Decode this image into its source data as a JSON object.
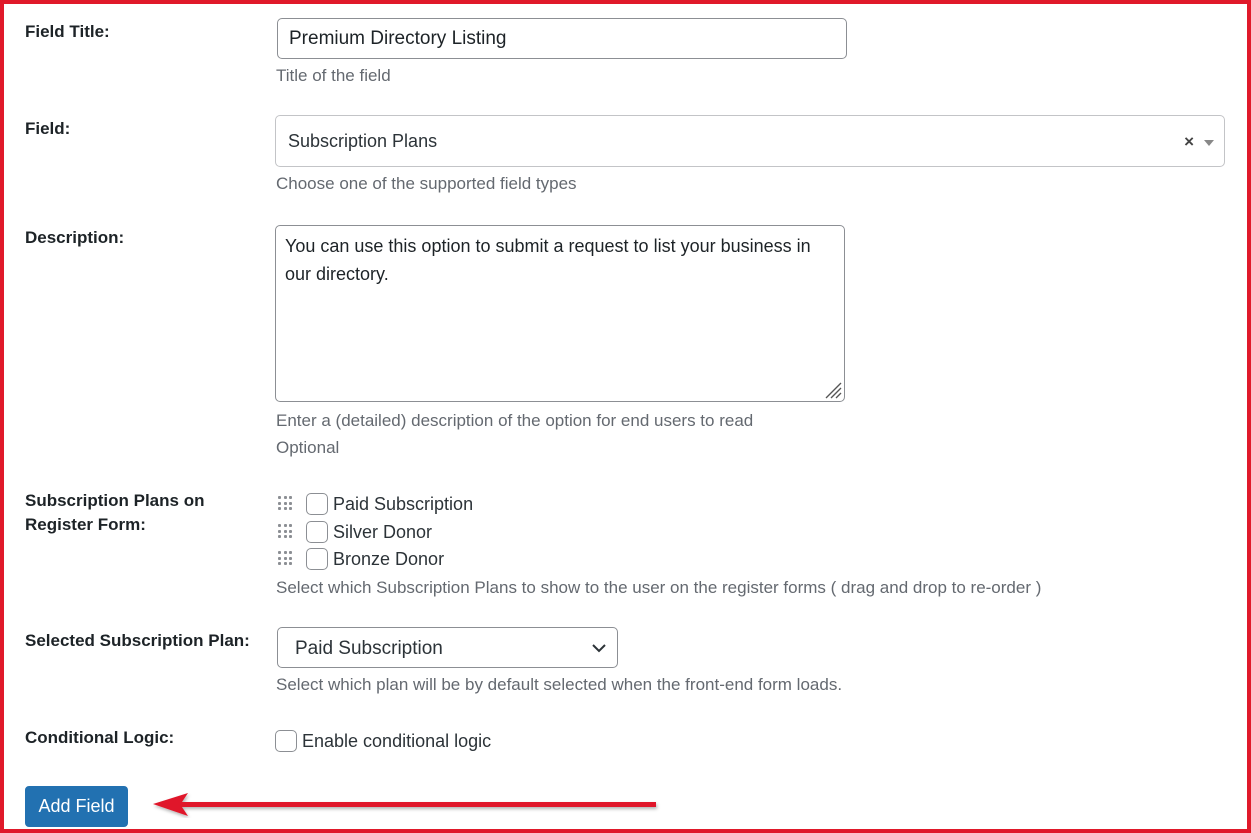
{
  "field_title": {
    "label": "Field Title:",
    "value": "Premium Directory Listing",
    "help": "Title of the field"
  },
  "field": {
    "label": "Field:",
    "value": "Subscription Plans",
    "clear_glyph": "×",
    "help": "Choose one of the supported field types"
  },
  "description": {
    "label": "Description:",
    "value": "You can use this option to submit a request to list your business in our directory.",
    "help_line1": "Enter a (detailed) description of the option for end users to read",
    "help_line2": "Optional"
  },
  "subscription_plans": {
    "label_line1": "Subscription Plans on",
    "label_line2": "Register Form:",
    "plans": [
      {
        "label": "Paid Subscription",
        "checked": false
      },
      {
        "label": "Silver Donor",
        "checked": false
      },
      {
        "label": "Bronze Donor",
        "checked": false
      }
    ],
    "help": "Select which Subscription Plans to show to the user on the register forms ( drag and drop to re-order )"
  },
  "selected_plan": {
    "label": "Selected Subscription Plan:",
    "value": "Paid Subscription",
    "help": "Select which plan will be by default selected when the front-end form loads."
  },
  "conditional_logic": {
    "label": "Conditional Logic:",
    "checkbox_label": "Enable conditional logic",
    "checked": false
  },
  "add_button": {
    "label": "Add Field"
  },
  "colors": {
    "frame_border": "#e0192a",
    "primary_button": "#2271b1",
    "annotation_arrow": "#e0192a",
    "help_text": "#646970"
  },
  "icons": {
    "drag": "drag-handle-icon",
    "clear": "clear-selection-icon",
    "caret": "caret-down-icon",
    "chevron": "chevron-down-icon",
    "resize": "resize-grip-icon",
    "arrow": "annotation-arrow-icon"
  }
}
